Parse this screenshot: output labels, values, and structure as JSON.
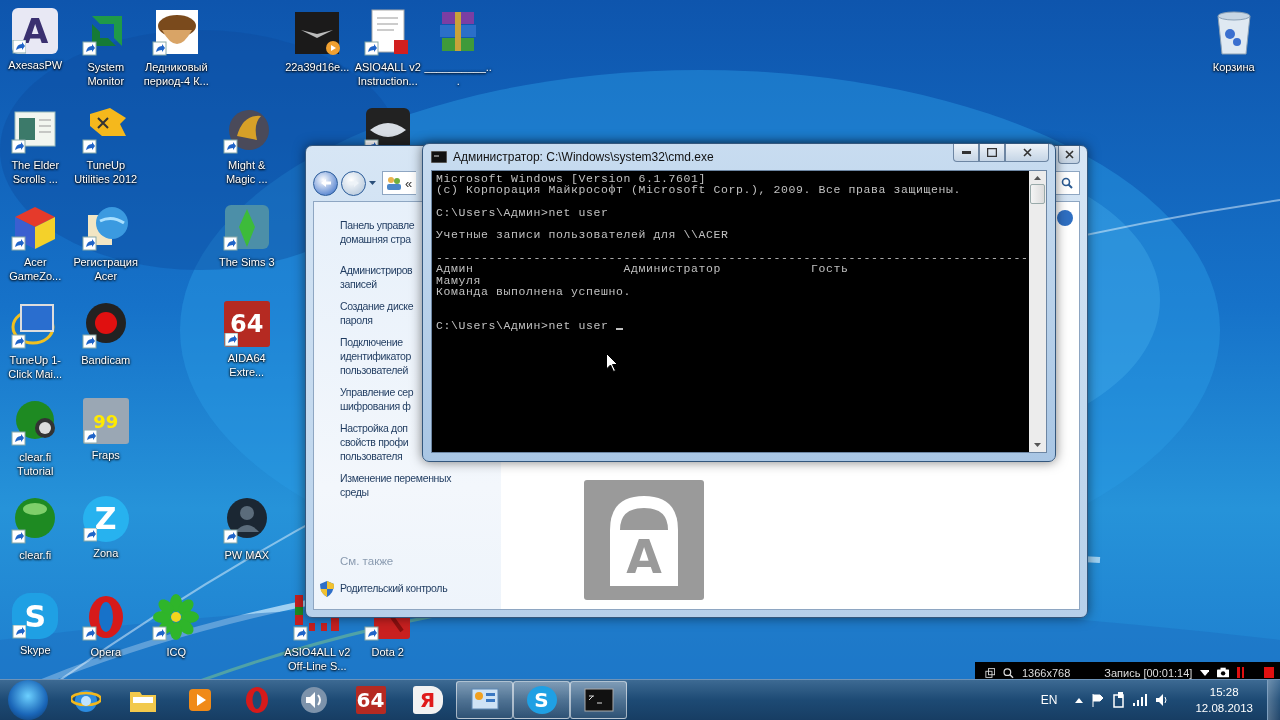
{
  "desktop_icons": [
    {
      "label": "AxesasPW",
      "glyph": "A",
      "shortcut": true
    },
    {
      "label": "System Monitor",
      "shortcut": true
    },
    {
      "label": "Ледниковый период-4 К...",
      "shortcut": true
    },
    {
      "label": "22a39d16e...",
      "shortcut": false
    },
    {
      "label": "ASIO4ALL v2 Instruction...",
      "shortcut": true
    },
    {
      "label": "__________...",
      "shortcut": false
    },
    {
      "label": "Корзина",
      "shortcut": false
    },
    {
      "label": "The Elder Scrolls ...",
      "shortcut": true
    },
    {
      "label": "TuneUp Utilities 2012",
      "shortcut": true
    },
    {
      "label": "Might & Magic ...",
      "shortcut": true
    },
    {
      "shortcut": true
    },
    {
      "label": "Acer GameZo...",
      "shortcut": true
    },
    {
      "label": "Регистрация Acer",
      "shortcut": true
    },
    {
      "label": "The Sims 3",
      "shortcut": true
    },
    {
      "label": "TuneUp 1-Click Mai...",
      "shortcut": true
    },
    {
      "label": "Bandicam",
      "shortcut": true
    },
    {
      "label": "AIDA64 Extre...",
      "glyph": "64",
      "shortcut": true
    },
    {
      "label": "clear.fi Tutorial",
      "shortcut": true
    },
    {
      "label": "Fraps",
      "glyph": "99",
      "shortcut": true
    },
    {
      "label": "clear.fi",
      "shortcut": true
    },
    {
      "label": "Zona",
      "glyph": "Z",
      "shortcut": true
    },
    {
      "label": "PW MAX",
      "shortcut": true
    },
    {
      "label": "Skype",
      "glyph": "S",
      "shortcut": true
    },
    {
      "label": "Opera",
      "shortcut": true
    },
    {
      "label": "ICQ",
      "shortcut": true
    },
    {
      "label": "ASIO4ALL v2 Off-Line S...",
      "shortcut": true
    },
    {
      "label": "Dota 2",
      "shortcut": true
    }
  ],
  "explorer": {
    "address_prefix": "«",
    "links": [
      [
        "Панель управле",
        "домашняя стра"
      ],
      [
        "Администриров",
        "записей"
      ],
      [
        "Создание диске",
        "пароля"
      ],
      [
        "Подключение",
        "идентификатор",
        "пользователей"
      ],
      [
        "Управление сер",
        "шифрования ф"
      ],
      [
        "Настройка доп",
        "свойств профи",
        "пользователя"
      ],
      [
        "Изменение переменных",
        "среды"
      ]
    ],
    "see_also": "См. также",
    "see_also_link": "Родительский контроль",
    "tile_glyph": "A"
  },
  "cmd": {
    "title": "Администратор: C:\\Windows\\system32\\cmd.exe",
    "blocks": [
      [
        "Microsoft Windows [Version 6.1.7601]",
        "(c) Корпорация Майкрософт (Microsoft Corp.), 2009. Все права защищены."
      ],
      [
        "C:\\Users\\Админ>net user"
      ],
      [
        "Учетные записи пользователей для \\\\ACER"
      ],
      [
        "-------------------------------------------------------------------------------",
        "Админ                    Администратор            Гость",
        "Мамуля",
        "Команда выполнена успешно."
      ]
    ],
    "prompt": "C:\\Users\\Админ>net user "
  },
  "taskbar": {
    "buttons": [
      {
        "kind": "browser",
        "running": false
      },
      {
        "kind": "folder",
        "running": false
      },
      {
        "kind": "player",
        "running": false
      },
      {
        "kind": "opera",
        "running": false
      },
      {
        "kind": "speaker",
        "running": false
      },
      {
        "kind": "tile",
        "glyph": "64",
        "running": false
      },
      {
        "kind": "tag",
        "glyph": "Я",
        "running": false
      },
      {
        "kind": "panel",
        "running": true
      },
      {
        "kind": "round",
        "glyph": "S",
        "running": true
      },
      {
        "kind": "console",
        "running": true
      }
    ],
    "language": "EN",
    "time": "15:28",
    "date": "12.08.2013"
  },
  "recorder": {
    "resolution": "1366x768",
    "status": "Запись [00:01:14]"
  }
}
